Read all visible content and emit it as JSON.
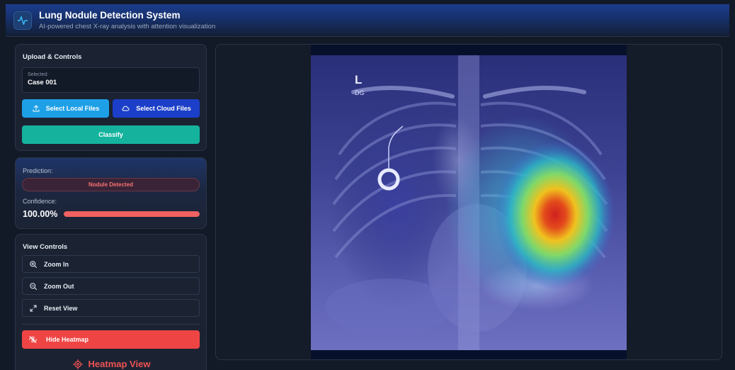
{
  "header": {
    "logo_icon": "activity-pulse-icon",
    "title": "Lung Nodule Detection System",
    "subtitle": "AI-powered chest X-ray analysis with attention visualization"
  },
  "upload": {
    "title": "Upload & Controls",
    "selected_label": "Selected:",
    "selected_value": "Case 001",
    "local_button": "Select Local Files",
    "local_icon": "upload-icon",
    "cloud_button": "Select Cloud Files",
    "cloud_icon": "cloud-icon",
    "classify_button": "Classify"
  },
  "prediction": {
    "label": "Prediction:",
    "result": "Nodule Detected",
    "confidence_label": "Confidence:",
    "confidence_text": "100.00%",
    "confidence_fraction": 1.0
  },
  "view_controls": {
    "title": "View Controls",
    "zoom_in": "Zoom In",
    "zoom_out": "Zoom Out",
    "reset_view": "Reset View",
    "hide_heatmap": "Hide Heatmap",
    "heatmap_view_title": "Heatmap View"
  },
  "viewer": {
    "marker_letter": "L",
    "marker_sub": "DG"
  },
  "colors": {
    "accent_blue": "#1ea0e6",
    "accent_indigo": "#1b3fc9",
    "accent_teal": "#15b39d",
    "danger": "#ef4444",
    "background": "#121a28",
    "panel": "#1b2333"
  }
}
